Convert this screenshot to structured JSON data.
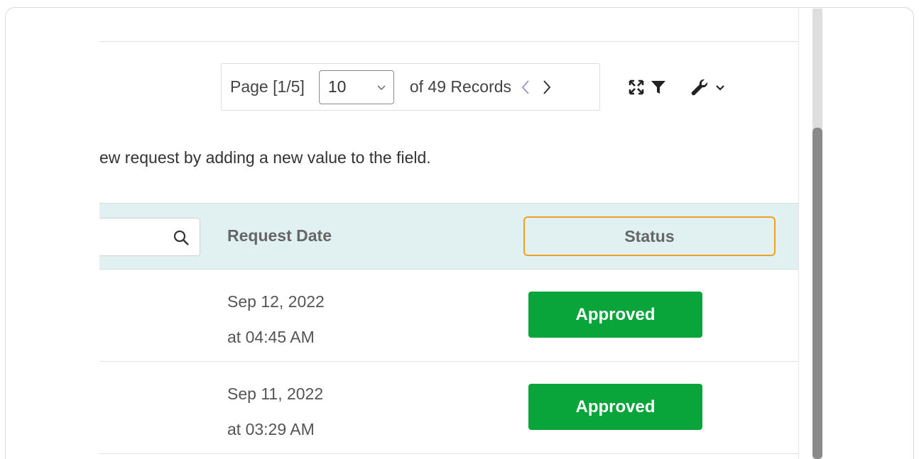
{
  "pagination": {
    "page_label": "Page [1/5]",
    "page_size": "10",
    "records_label": "of 49 Records"
  },
  "instruction": "ew request by adding a new value to the field.",
  "table": {
    "columns": {
      "request_date": "Request Date",
      "status": "Status"
    },
    "rows": [
      {
        "date": "Sep 12, 2022",
        "time": "at 04:45 AM",
        "status": "Approved"
      },
      {
        "date": "Sep 11, 2022",
        "time": "at 03:29 AM",
        "status": "Approved"
      }
    ]
  },
  "colors": {
    "header_bg": "#e1f0f0",
    "status_approved": "#0aa53a",
    "highlight_border": "#f0a020"
  },
  "icons": [
    "chevron-down-icon",
    "chevron-left-icon",
    "chevron-right-icon",
    "expand-icon",
    "filter-icon",
    "wrench-icon",
    "search-icon"
  ]
}
